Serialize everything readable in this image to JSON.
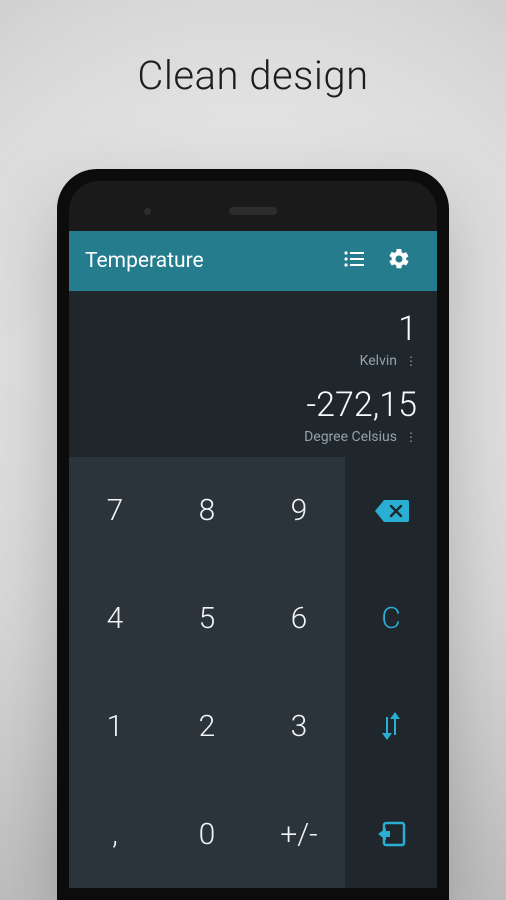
{
  "tagline": "Clean design",
  "appbar": {
    "title": "Temperature"
  },
  "display": {
    "input_value": "1",
    "input_unit": "Kelvin",
    "output_value": "-272,15",
    "output_unit": "Degree Celsius"
  },
  "keypad": {
    "d7": "7",
    "d8": "8",
    "d9": "9",
    "d4": "4",
    "d5": "5",
    "d6": "6",
    "d1": "1",
    "d2": "2",
    "d3": "3",
    "comma": ",",
    "d0": "0",
    "plusminus": "+/-",
    "clear": "C"
  },
  "colors": {
    "accent": "#2baed4",
    "appbar": "#247c8d",
    "display_bg": "#1f262c",
    "keypad_bg": "#2b343b"
  }
}
